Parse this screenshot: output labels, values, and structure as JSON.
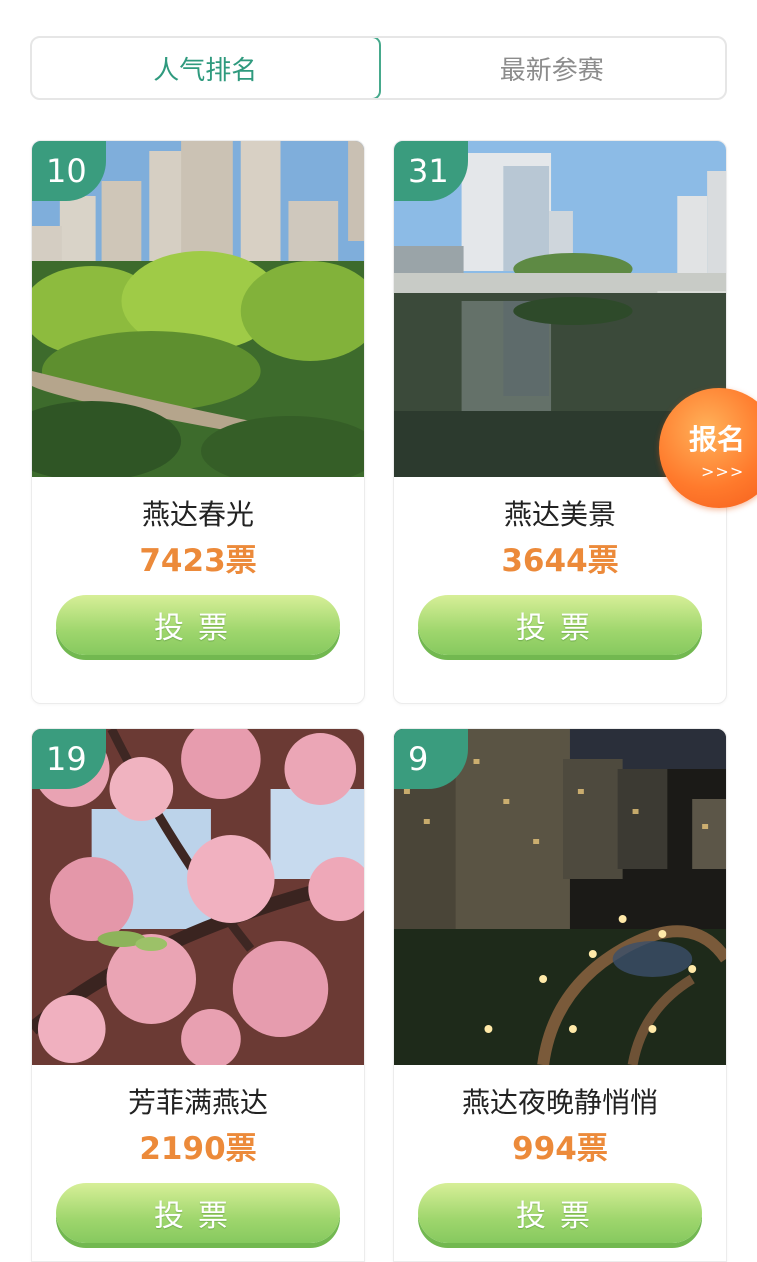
{
  "tabs": [
    {
      "label": "人气排名",
      "active": true
    },
    {
      "label": "最新参赛",
      "active": false
    }
  ],
  "entries": [
    {
      "rank": "10",
      "title": "燕达春光",
      "votes": "7423票",
      "button": "投票",
      "scene": "spring-garden-buildings"
    },
    {
      "rank": "31",
      "title": "燕达美景",
      "votes": "3644票",
      "button": "投票",
      "scene": "lake-reflection-buildings"
    },
    {
      "rank": "19",
      "title": "芳菲满燕达",
      "votes": "2190票",
      "button": "投票",
      "scene": "pink-cherry-blossoms"
    },
    {
      "rank": "9",
      "title": "燕达夜晚静悄悄",
      "votes": "994票",
      "button": "投票",
      "scene": "night-residential-lights"
    }
  ],
  "signup_badge": {
    "label": "报名",
    "arrows": ">>>"
  },
  "colors": {
    "accent": "#3a9c7e",
    "votes": "#ec8a3a",
    "button": "#9fd66d",
    "badge": "#ff7a2c"
  }
}
